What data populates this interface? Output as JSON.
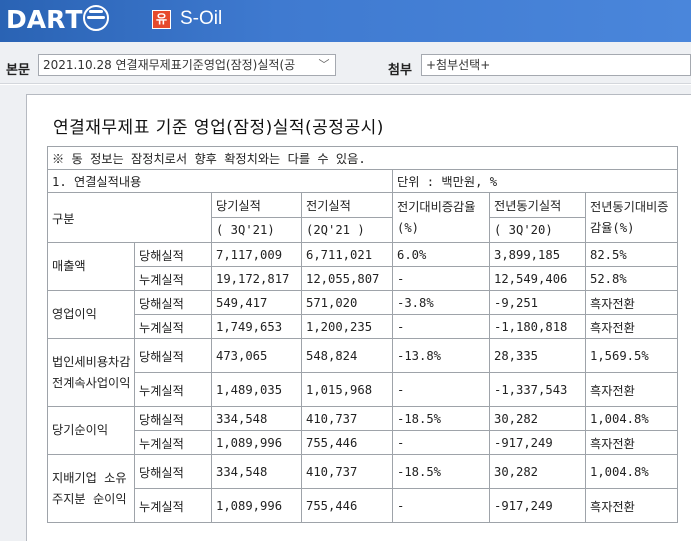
{
  "header": {
    "logo_text": "DART",
    "company_badge": "유",
    "company_name": "S-Oil"
  },
  "toolbar": {
    "main_label": "본문",
    "main_select_value": "2021.10.28  연결재무제표기준영업(잠정)실적(공",
    "attach_label": "첨부",
    "attach_select_value": "+첨부선택+"
  },
  "document": {
    "title": "연결재무제표 기준 영업(잠정)실적(공정공시)",
    "notice": "※ 동 정보는 잠정치로서 향후 확정치와는 다를 수 있음.",
    "section_label": "1. 연결실적내용",
    "unit_label": "단위 : 백만원, %",
    "headers": {
      "category": "구분",
      "current_line1": "당기실적",
      "current_line2": "( 3Q'21)",
      "previous_line1": "전기실적",
      "previous_line2": "(2Q'21 )",
      "qoq": "전기대비증감율(%)",
      "yoy_base_line1": "전년동기실적",
      "yoy_base_line2": "( 3Q'20)",
      "yoy": "전년동기대비증감율(%)"
    },
    "groups": [
      {
        "name": "매출액",
        "rows": [
          {
            "type": "당해실적",
            "current": "7,117,009",
            "previous": "6,711,021",
            "qoq": "6.0%",
            "yoy_base": "3,899,185",
            "yoy": "82.5%"
          },
          {
            "type": "누계실적",
            "current": "19,172,817",
            "previous": "12,055,807",
            "qoq": "-",
            "yoy_base": "12,549,406",
            "yoy": "52.8%"
          }
        ]
      },
      {
        "name": "영업이익",
        "rows": [
          {
            "type": "당해실적",
            "current": "549,417",
            "previous": "571,020",
            "qoq": "-3.8%",
            "yoy_base": "-9,251",
            "yoy": "흑자전환"
          },
          {
            "type": "누계실적",
            "current": "1,749,653",
            "previous": "1,200,235",
            "qoq": "-",
            "yoy_base": "-1,180,818",
            "yoy": "흑자전환"
          }
        ]
      },
      {
        "name": "법인세비용차감전계속사업이익",
        "rows": [
          {
            "type": "당해실적",
            "current": "473,065",
            "previous": "548,824",
            "qoq": "-13.8%",
            "yoy_base": "28,335",
            "yoy": "1,569.5%"
          },
          {
            "type": "누계실적",
            "current": "1,489,035",
            "previous": "1,015,968",
            "qoq": "-",
            "yoy_base": "-1,337,543",
            "yoy": "흑자전환"
          }
        ]
      },
      {
        "name": "당기순이익",
        "rows": [
          {
            "type": "당해실적",
            "current": "334,548",
            "previous": "410,737",
            "qoq": "-18.5%",
            "yoy_base": "30,282",
            "yoy": "1,004.8%"
          },
          {
            "type": "누계실적",
            "current": "1,089,996",
            "previous": "755,446",
            "qoq": "-",
            "yoy_base": "-917,249",
            "yoy": "흑자전환"
          }
        ]
      },
      {
        "name": "지배기업 소유주지분 순이익",
        "rows": [
          {
            "type": "당해실적",
            "current": "334,548",
            "previous": "410,737",
            "qoq": "-18.5%",
            "yoy_base": "30,282",
            "yoy": "1,004.8%"
          },
          {
            "type": "누계실적",
            "current": "1,089,996",
            "previous": "755,446",
            "qoq": "-",
            "yoy_base": "-917,249",
            "yoy": "흑자전환"
          }
        ]
      }
    ]
  }
}
